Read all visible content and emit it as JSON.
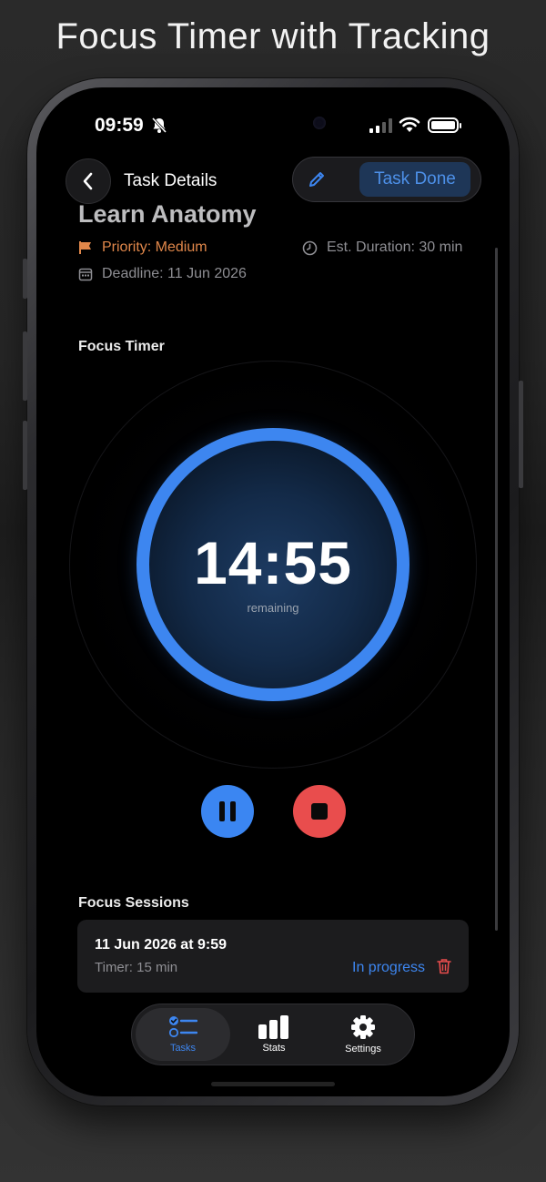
{
  "headline": "Focus Timer with Tracking",
  "status_bar": {
    "time": "09:59"
  },
  "nav": {
    "title": "Task Details",
    "done_label": "Task Done"
  },
  "task": {
    "title": "Learn Anatomy",
    "priority": "Priority: Medium",
    "duration": "Est. Duration: 30 min",
    "deadline": "Deadline: 11 Jun 2026"
  },
  "timer": {
    "section_label": "Focus Timer",
    "value": "14:55",
    "sub_label": "remaining"
  },
  "sessions": {
    "section_label": "Focus Sessions",
    "items": [
      {
        "date": "11 Jun 2026 at 9:59",
        "timer": "Timer: 15 min",
        "status": "In progress"
      }
    ]
  },
  "tabs": [
    {
      "label": "Tasks",
      "icon": "checklist-icon",
      "active": true
    },
    {
      "label": "Stats",
      "icon": "bar-chart-icon",
      "active": false
    },
    {
      "label": "Settings",
      "icon": "gear-icon",
      "active": false
    }
  ],
  "colors": {
    "accent": "#3d86f0",
    "priority": "#e0874a",
    "stop": "#e94d4d",
    "done_bg": "#1e3657"
  }
}
